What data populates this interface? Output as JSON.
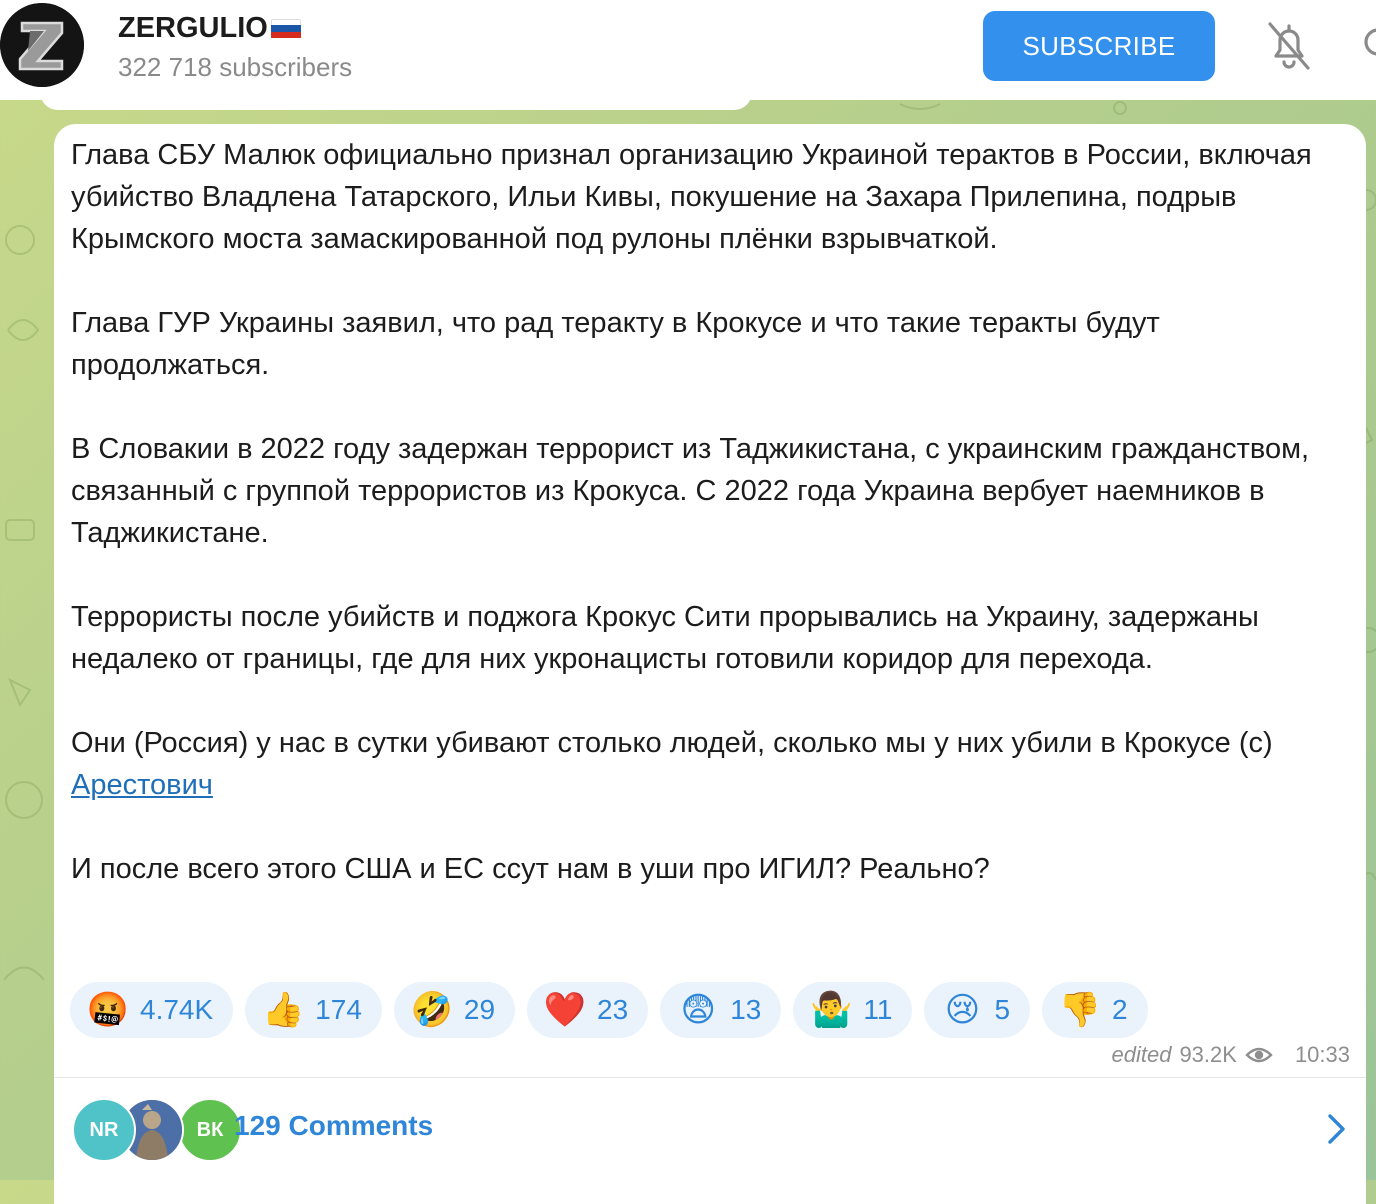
{
  "channel": {
    "name": "ZERGULIO",
    "flag": "russia-flag-icon",
    "subscribers": "322 718 subscribers",
    "avatar_letter": "Z"
  },
  "header": {
    "subscribe_label": "SUBSCRIBE",
    "mute_icon": "bell-off-icon",
    "search_icon": "search-icon"
  },
  "message": {
    "paragraphs": [
      "Глава СБУ Малюк официально признал организацию Украиной терактов в России, включая убийство Владлена Татарского, Ильи Кивы, покушение на Захара Прилепина, подрыв Крымского моста замаскированной под рулоны плёнки взрывчаткой.",
      "Глава ГУР Украины заявил, что рад теракту в Крокусе и что такие теракты будут продолжаться.",
      "В Словакии в 2022 году задержан террорист из Таджикистана, с украинским гражданством, связанный с группой террористов из Крокуса. С 2022 года Украина вербует наемников в Таджикистане.",
      "Террористы после убийств и поджога Крокус Сити прорывались на Украину, задержаны недалеко от границы, где для них укронацисты готовили коридор для перехода."
    ],
    "quote_prefix": "Они (Россия) у нас в сутки убивают столько людей, сколько мы у них убили в Крокусе (с) ",
    "quote_link": "Арестович",
    "closing": "И после всего этого США и ЕС ссут нам в уши про ИГИЛ? Реально?",
    "reactions": [
      {
        "emoji": "🤬",
        "count": "4.74K"
      },
      {
        "emoji": "👍",
        "count": "174"
      },
      {
        "emoji": "🤣",
        "count": "29"
      },
      {
        "emoji": "❤️",
        "count": "23"
      },
      {
        "emoji": "😨",
        "count": "13"
      },
      {
        "emoji": "🤷‍♂️",
        "count": "11"
      },
      {
        "emoji": "😢",
        "count": "5"
      },
      {
        "emoji": "👎",
        "count": "2"
      }
    ],
    "edited_label": "edited",
    "views": "93.2K",
    "time": "10:33"
  },
  "comments": {
    "label": "129 Comments",
    "avatars": [
      "NR",
      "",
      "ВК"
    ],
    "avatar_colors": [
      "#4fc3c8",
      "#6c7a8a",
      "#5fc14f"
    ]
  },
  "colors": {
    "accent": "#3390ec",
    "reaction_bg": "#eaf3fc",
    "reaction_text": "#2f86d8"
  }
}
